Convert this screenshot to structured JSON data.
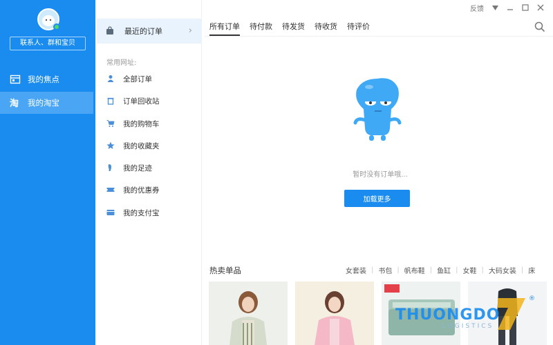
{
  "sidebar": {
    "search_placeholder": "联系人、群和宝贝",
    "items": [
      {
        "label": "我的焦点",
        "icon": "focus-icon"
      },
      {
        "label": "我的淘宝",
        "icon": "taobao-icon",
        "active": true
      }
    ]
  },
  "menu": {
    "recent_orders": "最近的订单",
    "section_label": "常用网址:",
    "items": [
      {
        "label": "全部订单",
        "icon": "orders-icon"
      },
      {
        "label": "订单回收站",
        "icon": "trash-icon"
      },
      {
        "label": "我的购物车",
        "icon": "cart-icon"
      },
      {
        "label": "我的收藏夹",
        "icon": "star-icon"
      },
      {
        "label": "我的足迹",
        "icon": "footprint-icon"
      },
      {
        "label": "我的优惠券",
        "icon": "coupon-icon"
      },
      {
        "label": "我的支付宝",
        "icon": "alipay-icon"
      }
    ]
  },
  "window": {
    "feedback": "反馈"
  },
  "tabs": [
    "所有订单",
    "待付款",
    "待发货",
    "待收货",
    "待评价"
  ],
  "empty": {
    "message": "暂时没有订单哦...",
    "load_more": "加载更多"
  },
  "hot": {
    "title": "热卖单品",
    "categories": [
      "女套装",
      "书包",
      "帆布鞋",
      "鱼缸",
      "女鞋",
      "大码女装",
      "床"
    ]
  },
  "watermark": {
    "brand": "THUONGDO",
    "sub": "LOGISTICS",
    "reg": "®"
  },
  "colors": {
    "accent": "#1a8cf0",
    "sidebar_active": "#4aa6f4",
    "menu_highlight": "#e9f3fd"
  }
}
